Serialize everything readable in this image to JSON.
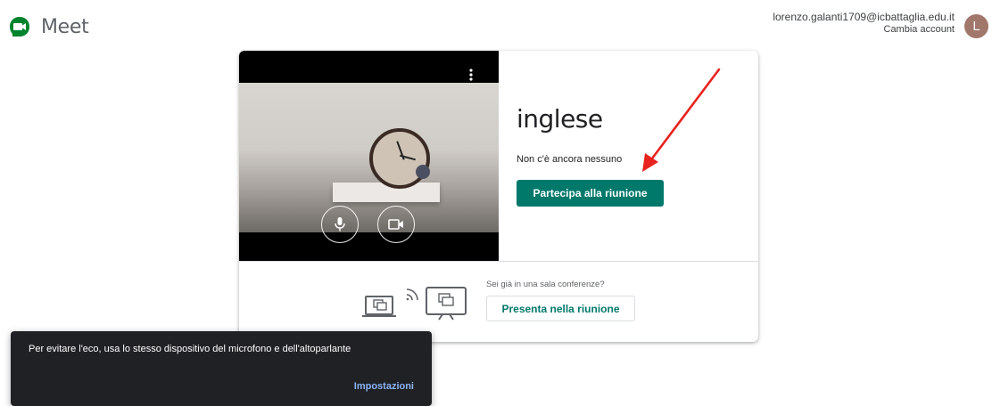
{
  "header": {
    "app_name": "Meet",
    "account_email": "lorenzo.galanti1709@icbattaglia.edu.it",
    "switch_account": "Cambia account",
    "avatar_initial": "L"
  },
  "meeting": {
    "title": "inglese",
    "status": "Non c'è ancora nessuno",
    "join_label": "Partecipa alla riunione",
    "present_question": "Sei già in una sala conferenze?",
    "present_label": "Presenta nella riunione"
  },
  "snackbar": {
    "message": "Per evitare l'eco, usa lo stesso dispositivo del microfono e dell'altoparlante",
    "action": "Impostazioni"
  },
  "icons": {
    "logo": "google-meet-logo",
    "more": "more-vert-icon",
    "mic": "mic-icon",
    "camera": "videocam-icon",
    "present": "present-screen-icon",
    "arrow": "red-arrow-annotation"
  },
  "colors": {
    "accent": "#00796b",
    "snackbar_bg": "#202124",
    "snackbar_action": "#8ab4f8",
    "avatar_bg": "#a1766b",
    "annotation": "#e8231f"
  }
}
